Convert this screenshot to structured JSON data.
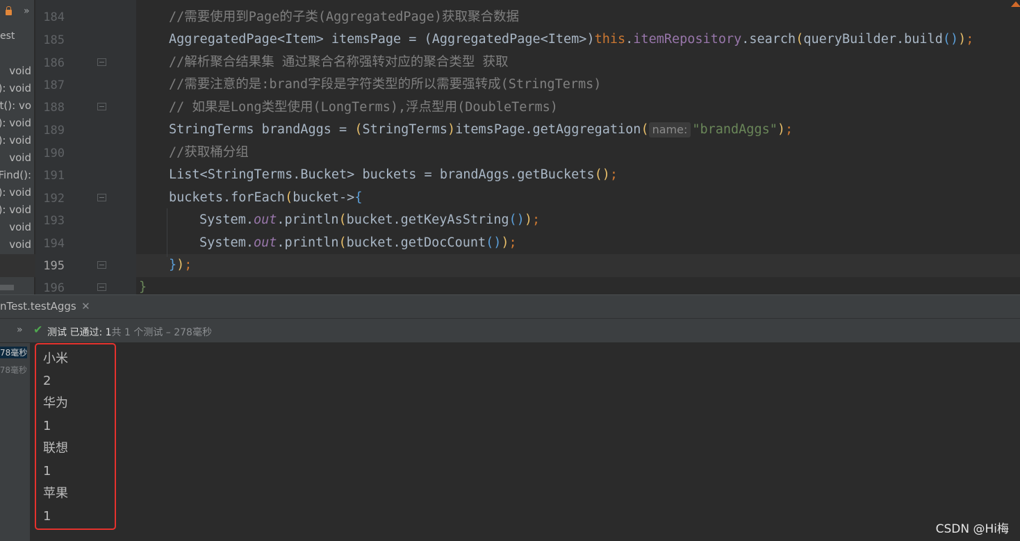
{
  "structure": {
    "header_text": "est",
    "methods": [
      " void",
      "(): void",
      ".ist(): vo",
      "(): void",
      "(): void",
      "void",
      "nFind():",
      "(): void",
      "(): void",
      "void",
      "void",
      " void"
    ]
  },
  "gutter": {
    "line_numbers": [
      "184",
      "185",
      "186",
      "187",
      "188",
      "189",
      "190",
      "191",
      "192",
      "193",
      "194",
      "195",
      "196"
    ],
    "current_line": "195"
  },
  "code": {
    "l184": "//需要使用到Page的子类(AggregatedPage)获取聚合数据",
    "l185_a": "AggregatedPage<Item> itemsPage = (AggregatedPage<Item>)",
    "l185_this": "this",
    "l185_dot": ".",
    "l185_field": "itemRepository",
    "l185_b": ".search",
    "l185_p1": "(",
    "l185_c": "queryBuilder.build",
    "l185_p2": "()",
    "l185_p3": ")",
    "l185_semi": ";",
    "l186": "//解析聚合结果集 通过聚合名称强转对应的聚合类型 获取",
    "l187": "//需要注意的是:brand字段是字符类型的所以需要强转成(StringTerms)",
    "l188": "// 如果是Long类型使用(LongTerms),浮点型用(DoubleTerms)",
    "l189_a": "StringTerms brandAggs = ",
    "l189_p1": "(",
    "l189_b": "StringTerms",
    "l189_p2": ")",
    "l189_c": "itemsPage.getAggregation",
    "l189_p3": "(",
    "l189_hint": "name:",
    "l189_str": "\"brandAggs\"",
    "l189_p4": ")",
    "l189_semi": ";",
    "l190": "//获取桶分组",
    "l191_a": "List<StringTerms.Bucket> buckets = brandAggs.getBuckets",
    "l191_p": "()",
    "l191_semi": ";",
    "l192_a": "buckets.forEach",
    "l192_p": "(",
    "l192_b": "bucket->",
    "l192_br": "{",
    "l193_a": "System.",
    "l193_out": "out",
    "l193_b": ".println",
    "l193_p1": "(",
    "l193_c": "bucket.getKeyAsString",
    "l193_p2": "()",
    "l193_p3": ")",
    "l193_semi": ";",
    "l194_a": "System.",
    "l194_out": "out",
    "l194_b": ".println",
    "l194_p1": "(",
    "l194_c": "bucket.getDocCount",
    "l194_p2": "()",
    "l194_p3": ")",
    "l194_semi": ";",
    "l195_br": "}",
    "l195_p": ")",
    "l195_semi": ";",
    "l196": "}"
  },
  "run_tab": {
    "label": "nTest.testAggs",
    "close": "✕"
  },
  "status": {
    "prefix": "测试 已通过: 1",
    "rest": "共 1 个测试 – 278毫秒"
  },
  "tree": {
    "rows": [
      "78毫秒",
      "78毫秒"
    ]
  },
  "console": {
    "lines": [
      "小米",
      "2",
      "华为",
      "1",
      "联想",
      "1",
      "苹果",
      "1"
    ]
  },
  "watermark": "CSDN @Hi梅",
  "colors": {
    "keyword": "#cc7832",
    "field": "#9876aa",
    "string": "#6a8759",
    "comment": "#808080",
    "highlight_box": "#e5322d",
    "pass_check": "#4fa84f"
  },
  "icons": {
    "lock": "lock-icon",
    "check": "check-icon",
    "more": "double-chevron-right-icon",
    "close": "close-icon"
  }
}
